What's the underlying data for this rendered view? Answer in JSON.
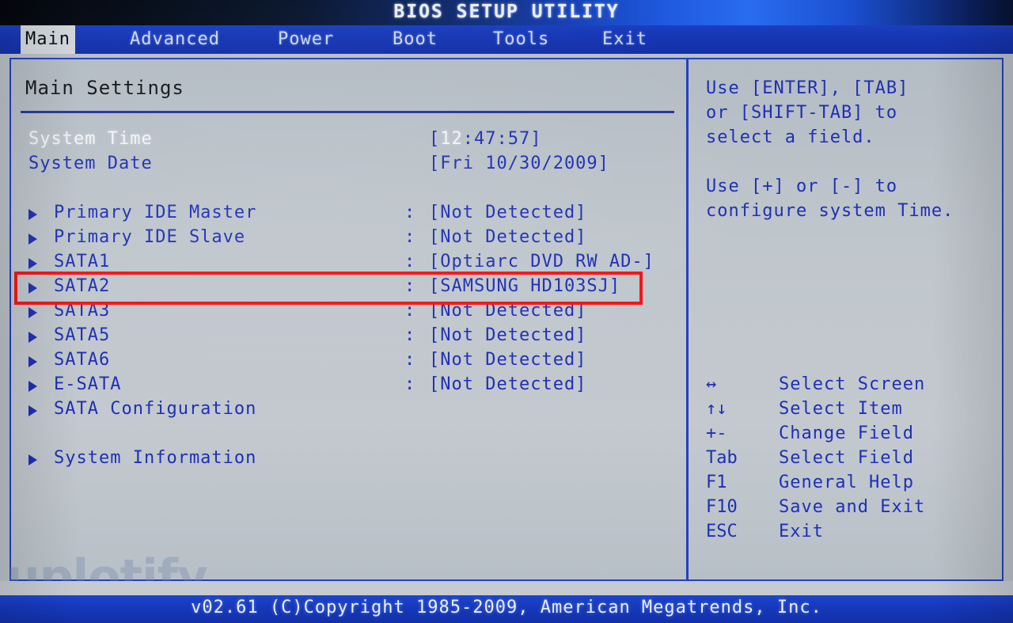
{
  "titlebar": {
    "title": "BIOS SETUP UTILITY"
  },
  "menu": {
    "items": [
      {
        "label": "Main",
        "active": true
      },
      {
        "label": "Advanced",
        "active": false
      },
      {
        "label": "Power",
        "active": false
      },
      {
        "label": "Boot",
        "active": false
      },
      {
        "label": "Tools",
        "active": false
      },
      {
        "label": "Exit",
        "active": false
      }
    ]
  },
  "main": {
    "section_title": "Main Settings",
    "fields": [
      {
        "label": "System Time",
        "value_prefix": "[",
        "value_highlight": "12",
        "value_rest": ":47:57]",
        "selected": true
      },
      {
        "label": "System Date",
        "value": "[Fri 10/30/2009]",
        "selected": false
      }
    ],
    "devices": [
      {
        "label": "Primary IDE Master",
        "colon": ":",
        "value": "[Not Detected]"
      },
      {
        "label": "Primary IDE Slave",
        "colon": ":",
        "value": "[Not Detected]"
      },
      {
        "label": "SATA1",
        "colon": ":",
        "value": "[Optiarc DVD RW AD-]"
      },
      {
        "label": "SATA2",
        "colon": ":",
        "value": "[SAMSUNG HD103SJ]"
      },
      {
        "label": "SATA3",
        "colon": ":",
        "value": "[Not Detected]"
      },
      {
        "label": "SATA5",
        "colon": ":",
        "value": "[Not Detected]"
      },
      {
        "label": "SATA6",
        "colon": ":",
        "value": "[Not Detected]"
      },
      {
        "label": "E-SATA",
        "colon": ":",
        "value": "[Not Detected]"
      }
    ],
    "submenus": [
      {
        "label": "SATA Configuration"
      },
      {
        "label": "System Information"
      }
    ]
  },
  "help": {
    "lines": [
      "Use [ENTER], [TAB]",
      "or [SHIFT-TAB] to",
      "select a field.",
      "Use [+] or [-] to",
      "configure system Time."
    ],
    "keys": [
      {
        "sym": "↔",
        "desc": "Select Screen"
      },
      {
        "sym": "↑↓",
        "desc": "Select Item"
      },
      {
        "sym": "+-",
        "desc": "Change Field"
      },
      {
        "sym": "Tab",
        "desc": "Select Field"
      },
      {
        "sym": "F1",
        "desc": "General Help"
      },
      {
        "sym": "F10",
        "desc": "Save and Exit"
      },
      {
        "sym": "ESC",
        "desc": "Exit"
      }
    ]
  },
  "footer": {
    "text": "v02.61 (C)Copyright 1985-2009, American Megatrends, Inc."
  },
  "watermark": {
    "text": "uplotify"
  },
  "annotation": {
    "target": "SATA2",
    "color": "#f41414"
  },
  "colors": {
    "accent_blue": "#1f2fb5",
    "bar_blue": "#1636b4",
    "panel_bg": "#bfc6cc",
    "highlight_white": "#f2f5f8",
    "annotation_red": "#f41414"
  }
}
